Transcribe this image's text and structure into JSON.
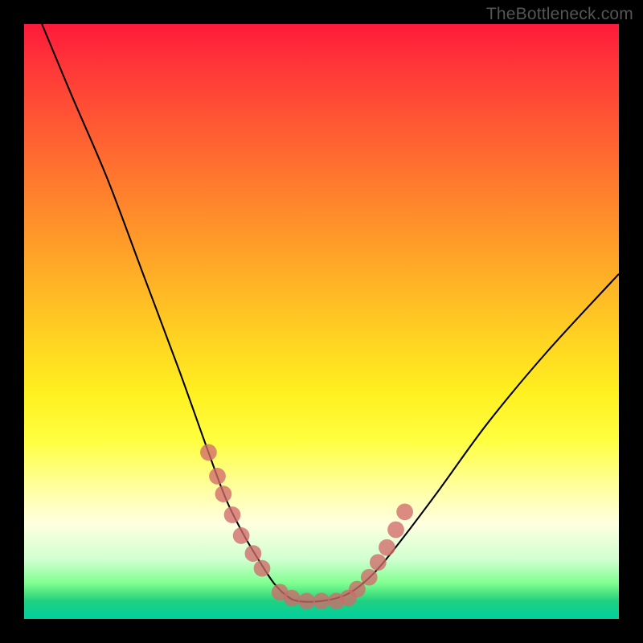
{
  "watermark": "TheBottleneck.com",
  "colors": {
    "dot": "#d16a6a",
    "curve": "#000000",
    "frame": "#000000"
  },
  "chart_data": {
    "type": "line",
    "title": "",
    "xlabel": "",
    "ylabel": "",
    "xlim": [
      0,
      100
    ],
    "ylim": [
      0,
      100
    ],
    "note": "No axes or tick labels are rendered; values are estimated from pixel geometry in a 0–100 coordinate space.",
    "series": [
      {
        "name": "bottleneck-curve",
        "x": [
          3,
          8,
          14,
          20,
          26,
          31,
          34,
          37,
          40,
          42,
          44,
          46,
          50,
          54,
          57,
          60,
          64,
          70,
          78,
          88,
          100
        ],
        "y": [
          100,
          88,
          74,
          58,
          42,
          28,
          20,
          14,
          9,
          6,
          4,
          3,
          3,
          4,
          6,
          9,
          14,
          22,
          33,
          45,
          58
        ]
      }
    ],
    "points": {
      "name": "highlight-dots",
      "x": [
        31.0,
        32.5,
        33.5,
        35.0,
        36.5,
        38.5,
        40.0,
        43.0,
        45.0,
        47.5,
        50.0,
        52.5,
        54.5,
        56.0,
        58.0,
        59.5,
        61.0,
        62.5,
        64.0
      ],
      "y": [
        28.0,
        24.0,
        21.0,
        17.5,
        14.0,
        11.0,
        8.5,
        4.5,
        3.5,
        3.0,
        3.0,
        3.0,
        3.5,
        5.0,
        7.0,
        9.5,
        12.0,
        15.0,
        18.0
      ],
      "radius": 1.4
    }
  }
}
